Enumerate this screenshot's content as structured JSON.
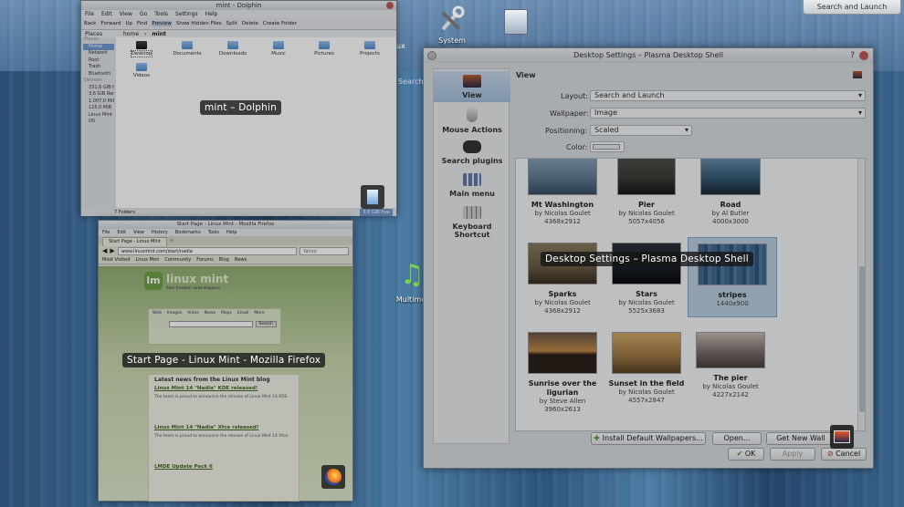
{
  "desktop": {
    "search_launch_label": "Search and Launch",
    "system_icon_label": "System",
    "multimedia_label": "Multime",
    "partial_left_text": "ux",
    "partial_search_text": "Search"
  },
  "dolphin": {
    "title": "mint - Dolphin",
    "overlay_label": "mint – Dolphin",
    "menu": [
      "File",
      "Edit",
      "View",
      "Go",
      "Tools",
      "Settings",
      "Help"
    ],
    "toolbar": [
      "Back",
      "Forward",
      "Up",
      "Find",
      "Preview",
      "Show Hidden Files",
      "Split",
      "Delete",
      "Create Folder"
    ],
    "breadcrumb": [
      "home",
      "mint"
    ],
    "places_header": "Places",
    "places_section": "Places",
    "places": [
      "Home",
      "Network",
      "Root",
      "Trash",
      "Bluetooth"
    ],
    "devices_section": "Devices",
    "devices": [
      "331,6 GiB Hard Drive",
      "3,6 GiB Removable",
      "1.007,0 MiB",
      "125,0 MiB",
      "Linux Mint",
      "OS"
    ],
    "files": [
      "Desktop",
      "Documents",
      "Downloads",
      "Music",
      "Pictures",
      "Projects",
      "Videos"
    ],
    "status": "7 Folders",
    "free_space": "3.6 GiB free"
  },
  "firefox": {
    "title": "Start Page - Linux Mint - Mozilla Firefox",
    "overlay_label": "Start Page - Linux Mint - Mozilla Firefox",
    "menu": [
      "File",
      "Edit",
      "View",
      "History",
      "Bookmarks",
      "Tools",
      "Help"
    ],
    "tab": "Start Page - Linux Mint",
    "url": "www.linuxmint.com/start/nadia",
    "search_engine": "Yahoo",
    "bookmarks": [
      "Most Visited",
      "Linux Mint",
      "Community",
      "Forums",
      "Blog",
      "News"
    ],
    "brand": "linux mint",
    "brand_tagline": "from freedom came elegance",
    "search_tabs": [
      "Web",
      "Images",
      "Video",
      "News",
      "Maps",
      "Email",
      "More"
    ],
    "search_button": "Search",
    "news_heading": "Latest news from the Linux Mint blog",
    "news": [
      {
        "title": "Linux Mint 14 \"Nadia\" KDE released!",
        "body": "The team is proud to announce the release of Linux Mint 14 KDE."
      },
      {
        "title": "Linux Mint 14 \"Nadia\" Xfce released!",
        "body": "The team is proud to announce the release of Linux Mint 14 Xfce."
      },
      {
        "title": "LMDE Update Pack 6",
        "body": ""
      }
    ]
  },
  "settings": {
    "title": "Desktop Settings – Plasma Desktop Shell",
    "overlay_label": "Desktop Settings – Plasma Desktop Shell",
    "sidebar": [
      "View",
      "Mouse Actions",
      "Search plugins",
      "Main menu",
      "Keyboard Shortcut"
    ],
    "sidebar_keyboard_line1": "Keyboard",
    "sidebar_keyboard_line2": "Shortcut",
    "section_title": "View",
    "layout_label": "Layout:",
    "layout_value": "Search and Launch",
    "wallpaper_label": "Wallpaper:",
    "wallpaper_value": "Image",
    "positioning_label": "Positioning:",
    "positioning_value": "Scaled",
    "color_label": "Color:",
    "wallpapers": [
      {
        "name": "Mt Washington",
        "author": "by Nicolas Goulet",
        "size": "4368x2912",
        "color": "#5d7a95"
      },
      {
        "name": "Pier",
        "author": "by Nicolas Goulet",
        "size": "5057x4056",
        "color": "#3d3a36"
      },
      {
        "name": "Road",
        "author": "by Al Butler",
        "size": "4000x3000",
        "color": "#2f5a7a"
      },
      {
        "name": "Sparks",
        "author": "by Nicolas Goulet",
        "size": "4368x2912",
        "color": "#6b5a40"
      },
      {
        "name": "Stars",
        "author": "by Nicolas Goulet",
        "size": "5525x3683",
        "color": "#1a1f2a"
      },
      {
        "name": "stripes",
        "author": "",
        "size": "1440x900",
        "color": "#3a6a96"
      },
      {
        "name": "Sunrise over the ligurian",
        "author": "by Steve Allen",
        "size": "3960x2613",
        "color": "#4a3a2a"
      },
      {
        "name": "Sunset in the field",
        "author": "by Nicolas Goulet",
        "size": "4557x2847",
        "color": "#a77a3a"
      },
      {
        "name": "The pier",
        "author": "by Nicolas Goulet",
        "size": "4227x2142",
        "color": "#7a6e6a"
      }
    ],
    "install_button": "Install Default Wallpapers...",
    "open_button": "Open...",
    "get_new_button": "Get New Wall",
    "ok_button": "OK",
    "apply_button": "Apply",
    "cancel_button": "Cancel"
  }
}
